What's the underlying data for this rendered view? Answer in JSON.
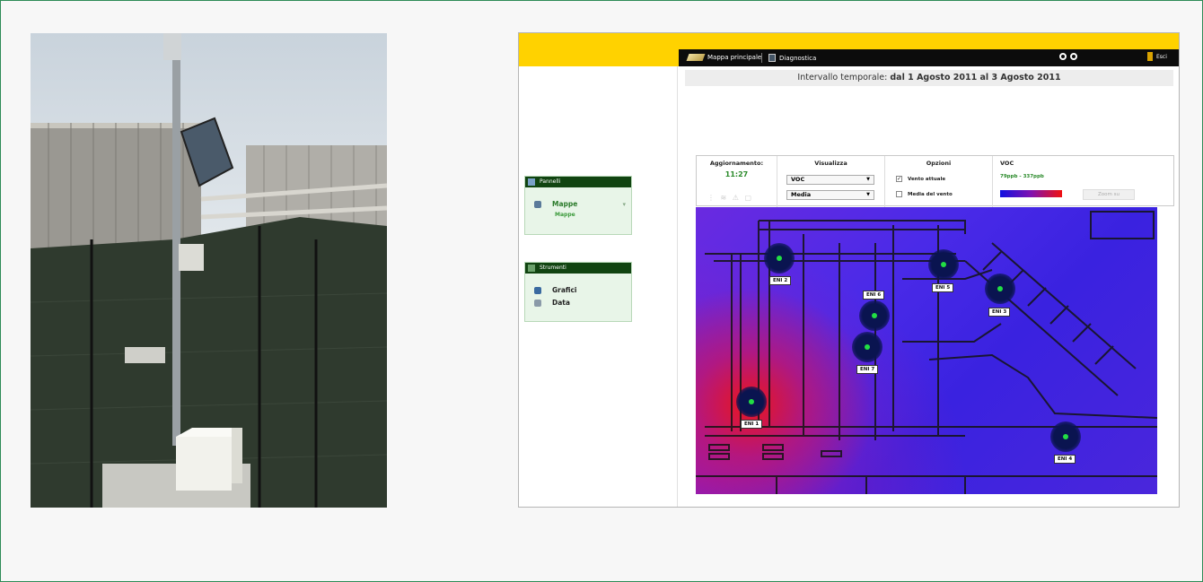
{
  "app": {
    "topbar": {
      "main_maps": "Mappa principale",
      "diagnostics": "Diagnostica",
      "exit": "Esci"
    },
    "interval": {
      "prefix": "Intervallo temporale:",
      "range": "dal 1 Agosto 2011 al 3 Agosto 2011"
    },
    "sidebar": {
      "panels_title": "Pannelli",
      "maps_label": "Mappe",
      "maps_sub": "Mappe",
      "tools_title": "Strumenti",
      "tools": [
        "Grafici",
        "Data"
      ]
    },
    "controls": {
      "update_title": "Aggiornamento:",
      "update_time": "11:27",
      "view_title": "Visualizza",
      "view_pollutant": "VOC",
      "view_mode": "Media",
      "options_title": "Opzioni",
      "option_current_wind": "Vento attuale",
      "option_current_wind_checked": true,
      "option_avg_wind": "Media del vento",
      "option_avg_wind_checked": false,
      "legend_title": "VOC",
      "legend_range": "79ppb - 337ppb",
      "legend_colors": [
        "#1010e0",
        "#f01010"
      ],
      "zoom_button": "Zoom su"
    },
    "sensors": [
      {
        "label": "ENI 2"
      },
      {
        "label": "ENI 5"
      },
      {
        "label": "ENI 6"
      },
      {
        "label": "ENI 3"
      },
      {
        "label": "ENI 7"
      },
      {
        "label": "ENI 1"
      },
      {
        "label": "ENI 4"
      }
    ],
    "colors": {
      "brand_yellow": "#ffd200",
      "topbar": "#0c0c0c",
      "panel_green": "#114411",
      "text_green": "#2a8a2a"
    }
  }
}
